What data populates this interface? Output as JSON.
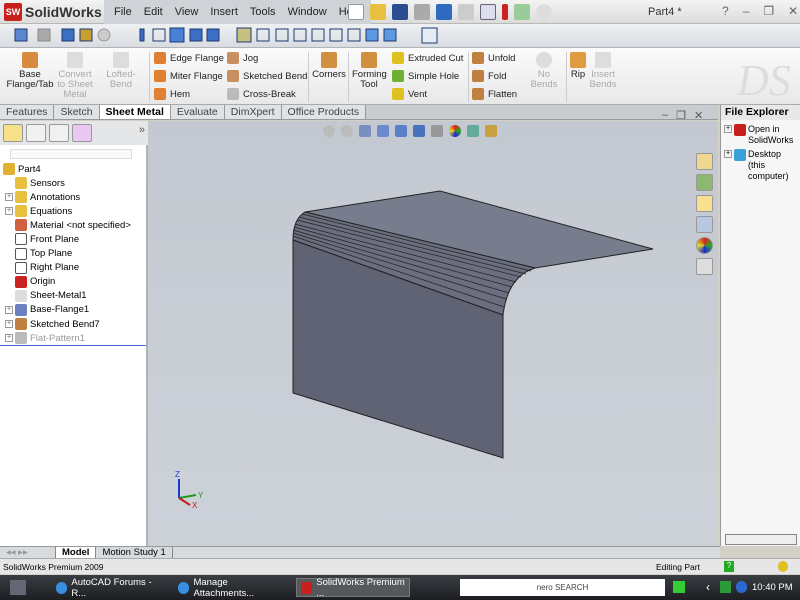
{
  "app": {
    "name": "SolidWorks",
    "document_title": "Part4 *"
  },
  "menu": [
    "File",
    "Edit",
    "View",
    "Insert",
    "Tools",
    "Window",
    "Help"
  ],
  "command_manager": {
    "big": [
      {
        "label": "Base Flange/Tab",
        "enabled": true
      },
      {
        "label": "Convert to Sheet Metal",
        "enabled": false
      },
      {
        "label": "Lofted-Bend",
        "enabled": false
      }
    ],
    "col1": [
      "Edge Flange",
      "Miter Flange",
      "Hem"
    ],
    "col2": [
      "Jog",
      "Sketched Bend",
      "Cross-Break"
    ],
    "corners": "Corners",
    "forming_tool": "Forming Tool",
    "col3": [
      "Extruded Cut",
      "Simple Hole",
      "Vent"
    ],
    "col4": [
      "Unfold",
      "Fold",
      "Flatten"
    ],
    "no_bends": "No Bends",
    "rip": "Rip",
    "insert_bends": "Insert Bends"
  },
  "tabs": [
    {
      "label": "Features"
    },
    {
      "label": "Sketch"
    },
    {
      "label": "Sheet Metal",
      "active": true
    },
    {
      "label": "Evaluate"
    },
    {
      "label": "DimXpert"
    },
    {
      "label": "Office Products"
    }
  ],
  "feature_tree": {
    "root": "Part4",
    "items": [
      {
        "label": "Sensors",
        "expandable": false
      },
      {
        "label": "Annotations",
        "expandable": true
      },
      {
        "label": "Equations",
        "expandable": true
      },
      {
        "label": "Material <not specified>",
        "expandable": false
      },
      {
        "label": "Front Plane",
        "expandable": false
      },
      {
        "label": "Top Plane",
        "expandable": false
      },
      {
        "label": "Right Plane",
        "expandable": false
      },
      {
        "label": "Origin",
        "expandable": false
      },
      {
        "label": "Sheet-Metal1",
        "expandable": false
      },
      {
        "label": "Base-Flange1",
        "expandable": true
      },
      {
        "label": "Sketched Bend7",
        "expandable": true
      },
      {
        "label": "Flat-Pattern1",
        "expandable": true,
        "suppressed": true
      }
    ]
  },
  "triad": {
    "z": "Z",
    "y": "Y",
    "x": "X"
  },
  "file_explorer": {
    "title": "File Explorer",
    "items": [
      "Open in SolidWorks",
      "Desktop (this computer)"
    ]
  },
  "bottom_tabs": [
    "Model",
    "Motion Study 1"
  ],
  "status": {
    "left": "SolidWorks Premium 2009",
    "right": "Editing Part"
  },
  "taskbar": {
    "tasks": [
      "AutoCAD Forums - R...",
      "Manage Attachments...",
      "SolidWorks Premium ..."
    ],
    "search": "nero SEARCH",
    "clock": "10:40 PM"
  },
  "colors": {
    "model_face": "#5f6373",
    "model_top": "#757a8a",
    "viewport_bg": "#c8cdd5",
    "accent": "#c8201c"
  }
}
